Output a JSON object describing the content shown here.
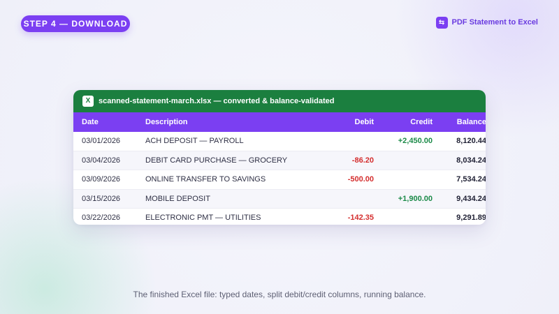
{
  "step": {
    "label": "STEP 4 — DOWNLOAD"
  },
  "brand": {
    "icon": "swap-arrows-icon",
    "label": "PDF Statement to Excel"
  },
  "sheet": {
    "icon_label": "X",
    "title": "scanned-statement-march.xlsx — converted & balance-validated",
    "columns": [
      "Date",
      "Description",
      "Debit",
      "Credit",
      "Balance"
    ],
    "rows": [
      {
        "date": "03/01/2026",
        "description": "ACH DEPOSIT — PAYROLL",
        "debit": "",
        "credit": "+2,450.00",
        "balance": "8,120.44"
      },
      {
        "date": "03/04/2026",
        "description": "DEBIT CARD PURCHASE — GROCERY",
        "debit": "-86.20",
        "credit": "",
        "balance": "8,034.24"
      },
      {
        "date": "03/09/2026",
        "description": "ONLINE TRANSFER TO SAVINGS",
        "debit": "-500.00",
        "credit": "",
        "balance": "7,534.24"
      },
      {
        "date": "03/15/2026",
        "description": "MOBILE DEPOSIT",
        "debit": "",
        "credit": "+1,900.00",
        "balance": "9,434.24"
      },
      {
        "date": "03/22/2026",
        "description": "ELECTRONIC PMT — UTILITIES",
        "debit": "-142.35",
        "credit": "",
        "balance": "9,291.89"
      }
    ]
  },
  "caption": "The finished Excel file: typed dates, split debit/credit columns, running balance.",
  "colors": {
    "accent": "#7b3ff2",
    "excel_green": "#1b7f3f",
    "debit": "#d42e2e",
    "credit": "#1b8a48"
  }
}
